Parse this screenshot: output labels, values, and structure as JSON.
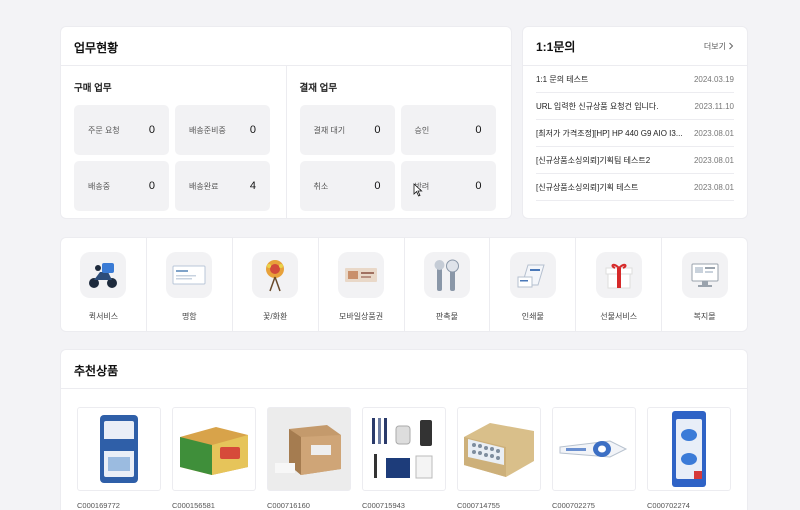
{
  "work": {
    "title": "업무현황",
    "purchase": {
      "title": "구매 업무",
      "tiles": [
        {
          "label": "주문 요청",
          "count": "0"
        },
        {
          "label": "배송준비중",
          "count": "0"
        },
        {
          "label": "배송중",
          "count": "0"
        },
        {
          "label": "배송완료",
          "count": "4"
        }
      ]
    },
    "approval": {
      "title": "결재 업무",
      "tiles": [
        {
          "label": "결재 대기",
          "count": "0"
        },
        {
          "label": "승인",
          "count": "0"
        },
        {
          "label": "취소",
          "count": "0"
        },
        {
          "label": "반려",
          "count": "0"
        }
      ]
    }
  },
  "inquiry": {
    "title": "1:1문의",
    "more": "더보기",
    "items": [
      {
        "title": "1:1 문의 테스트",
        "date": "2024.03.19"
      },
      {
        "title": "URL 입력한 신규상품 요청건 입니다.",
        "date": "2023.11.10"
      },
      {
        "title": "[최저가 가격조정][HP] HP 440 G9 AIO I3...",
        "date": "2023.08.01"
      },
      {
        "title": "[신규상품소싱의뢰]기획팀 테스트2",
        "date": "2023.08.01"
      },
      {
        "title": "[신규상품소싱의뢰]기획 테스트",
        "date": "2023.08.01"
      }
    ]
  },
  "services": [
    {
      "label": "퀵서비스",
      "icon": "scooter-icon"
    },
    {
      "label": "명함",
      "icon": "business-card-icon"
    },
    {
      "label": "꽃/화환",
      "icon": "flower-wreath-icon"
    },
    {
      "label": "모바일상품권",
      "icon": "gift-voucher-icon"
    },
    {
      "label": "판촉물",
      "icon": "promo-goods-icon"
    },
    {
      "label": "인쇄물",
      "icon": "printed-matter-icon"
    },
    {
      "label": "선물서비스",
      "icon": "gift-box-icon"
    },
    {
      "label": "복지몰",
      "icon": "welfare-mall-icon"
    }
  ],
  "recommended": {
    "title": "추천상품",
    "products": [
      {
        "code": "C000169772",
        "image": "tissue-pack-image"
      },
      {
        "code": "C000156581",
        "image": "snack-box-image"
      },
      {
        "code": "C000716160",
        "image": "cardboard-box-image"
      },
      {
        "code": "C000715943",
        "image": "office-set-image"
      },
      {
        "code": "C000714755",
        "image": "battery-box-image"
      },
      {
        "code": "C000702275",
        "image": "correction-tape-image"
      },
      {
        "code": "C000702274",
        "image": "correction-tape-pack-image"
      }
    ]
  }
}
